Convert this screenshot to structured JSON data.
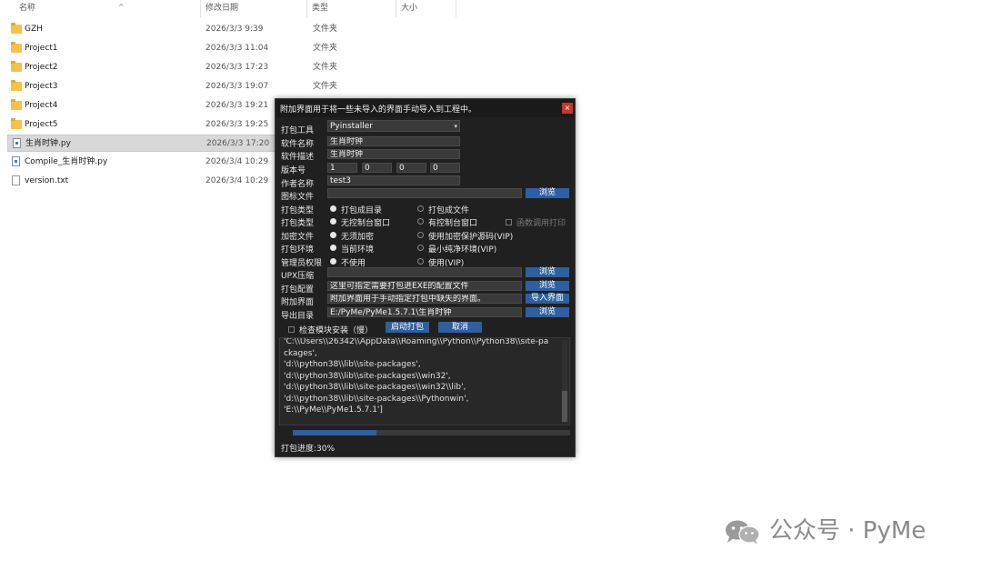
{
  "explorer": {
    "columns": {
      "name": "名称",
      "date": "修改日期",
      "type": "类型",
      "size": "大小"
    },
    "files": [
      {
        "name": "GZH",
        "date": "2026/3/3 9:39",
        "type": "文件夹",
        "icon": "folder-icon"
      },
      {
        "name": "Project1",
        "date": "2026/3/3 11:04",
        "type": "文件夹",
        "icon": "folder-icon"
      },
      {
        "name": "Project2",
        "date": "2026/3/3 17:23",
        "type": "文件夹",
        "icon": "folder-icon"
      },
      {
        "name": "Project3",
        "date": "2026/3/3 19:07",
        "type": "文件夹",
        "icon": "folder-icon"
      },
      {
        "name": "Project4",
        "date": "2026/3/3 19:21",
        "type": "文件夹",
        "icon": "folder-icon"
      },
      {
        "name": "Project5",
        "date": "2026/3/3 19:25",
        "type": "文件夹",
        "icon": "folder-icon"
      },
      {
        "name": "生肖时钟.py",
        "date": "2026/3/3 17:20",
        "type": "",
        "icon": "python-file-icon"
      },
      {
        "name": "Compile_生肖时钟.py",
        "date": "2026/3/4 10:29",
        "type": "",
        "icon": "python-file-icon"
      },
      {
        "name": "version.txt",
        "date": "2026/3/4 10:29",
        "type": "",
        "icon": "text-file-icon"
      }
    ]
  },
  "dialog": {
    "title": "附加界面用于将一些未导入的界面手动导入到工程中。",
    "close_label": "×",
    "labels": {
      "tool": "打包工具",
      "name": "软件名称",
      "desc": "软件描述",
      "version": "版本号",
      "author": "作者名称",
      "icon": "图标文件",
      "pack_type1": "打包类型",
      "pack_type2": "打包类型",
      "encrypt": "加密文件",
      "env": "打包环境",
      "admin": "管理员权限",
      "upx": "UPX压缩",
      "config": "打包配置",
      "extra_ui": "附加界面",
      "output": "导出目录"
    },
    "values": {
      "tool": "Pyinstaller",
      "name": "生肖时钟",
      "desc": "生肖时钟",
      "version": [
        "1",
        "0",
        "0",
        "0"
      ],
      "author": "test3",
      "icon": "",
      "upx": "",
      "config": "这里可指定需要打包进EXE的配置文件",
      "extra_ui": "附加界面用于手动指定打包中缺失的界面。",
      "output": "E:/PyMe/PyMe1.5.7.1\\生肖时钟"
    },
    "buttons": {
      "browse": "浏览",
      "import_ui": "导入界面",
      "start": "启动打包",
      "cancel": "取消"
    },
    "options": {
      "dir": "打包成目录",
      "file": "打包成文件",
      "no_console": "无控制台窗口",
      "console": "有控制台窗口",
      "func_print": "函数调用打印",
      "no_encrypt": "无须加密",
      "vip_encrypt": "使用加密保护源码(VIP)",
      "current_env": "当前环境",
      "min_env": "最小纯净环境(VIP)",
      "no_admin": "不使用",
      "use_admin": "使用(VIP)",
      "check_modules": "检查模块安装（慢）"
    },
    "log_lines": [
      "'C:\\\\Users\\\\26342\\\\AppData\\\\Roaming\\\\Python\\\\Python38\\\\site-pa",
      "ckages',",
      "'d:\\\\python38\\\\lib\\\\site-packages',",
      "'d:\\\\python38\\\\lib\\\\site-packages\\\\win32',",
      "'d:\\\\python38\\\\lib\\\\site-packages\\\\win32\\\\lib',",
      "'d:\\\\python38\\\\lib\\\\site-packages\\\\Pythonwin',",
      "'E:\\\\PyMe\\\\PyMe1.5.7.1']"
    ],
    "progress": 0.3,
    "progress_text": "打包进度:30%"
  },
  "watermark": {
    "text": "公众号 · PyMe",
    "icon": "wechat-icon"
  }
}
